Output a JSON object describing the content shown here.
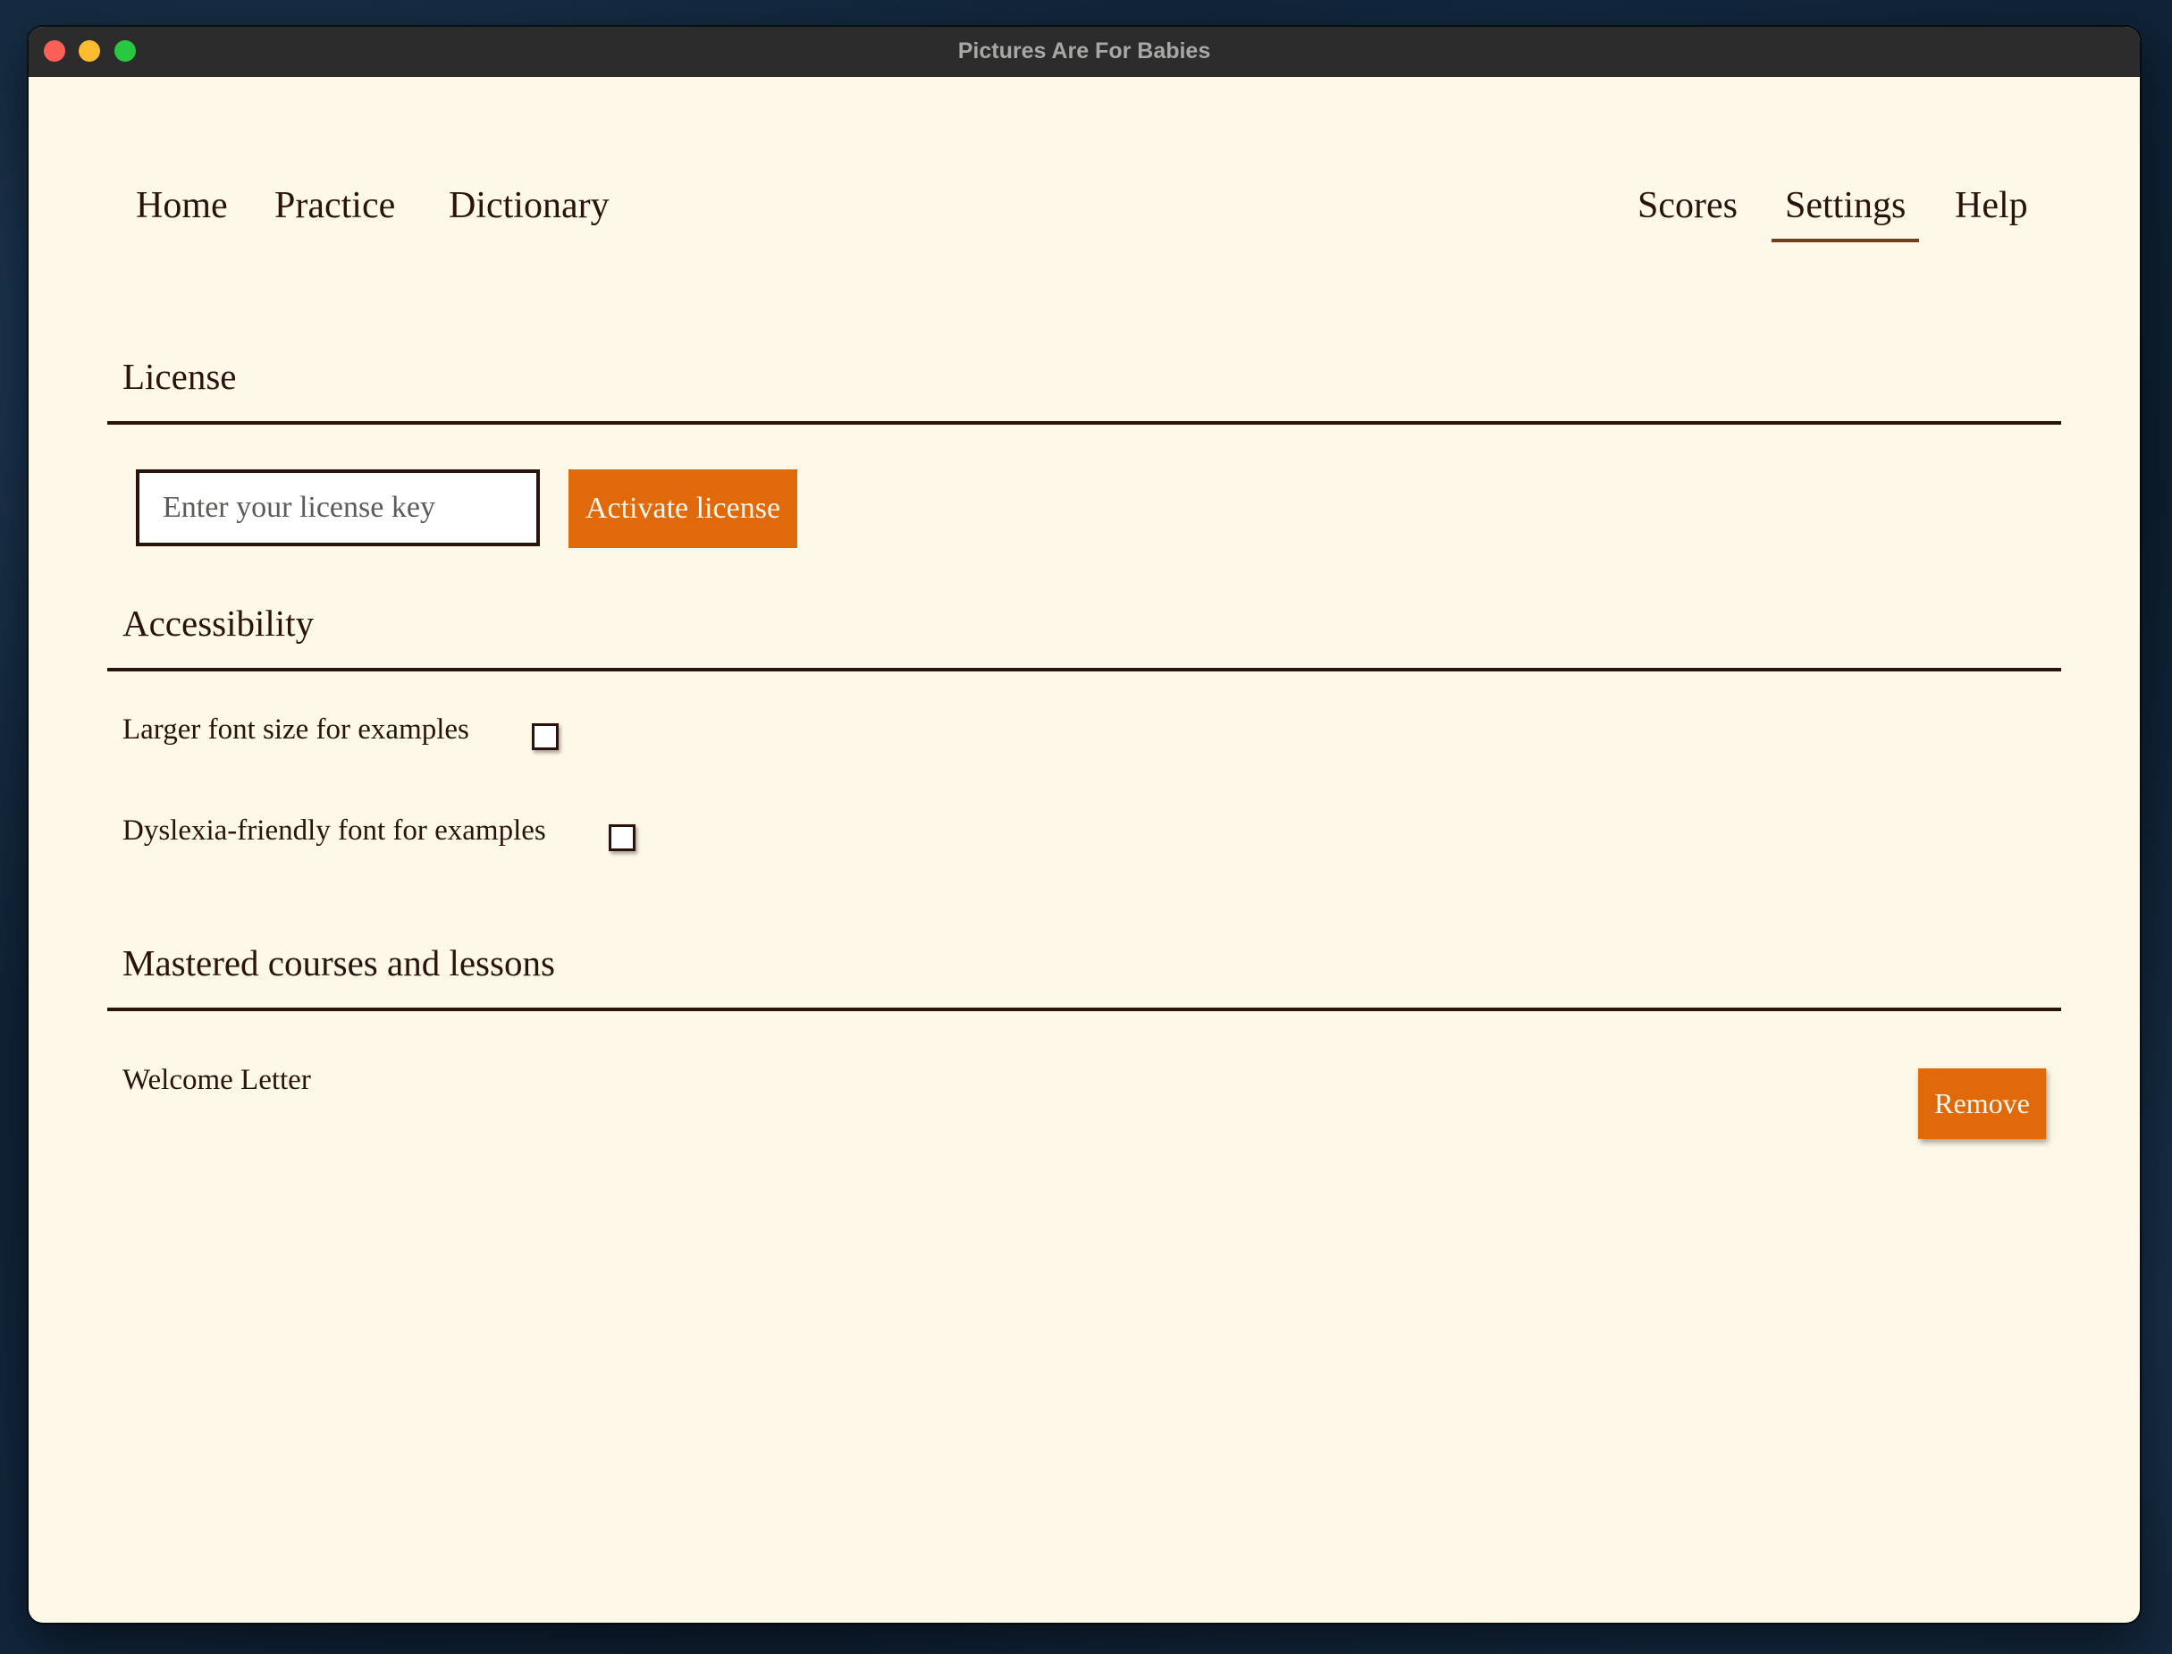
{
  "window": {
    "title": "Pictures Are For Babies"
  },
  "nav": {
    "left": [
      {
        "label": "Home"
      },
      {
        "label": "Practice"
      },
      {
        "label": "Dictionary"
      }
    ],
    "right": [
      {
        "label": "Scores"
      },
      {
        "label": "Settings",
        "active": true
      },
      {
        "label": "Help"
      }
    ]
  },
  "license": {
    "heading": "License",
    "input_placeholder": "Enter your license key",
    "input_value": "",
    "activate_label": "Activate license"
  },
  "accessibility": {
    "heading": "Accessibility",
    "options": [
      {
        "label": "Larger font size for examples",
        "checked": false
      },
      {
        "label": "Dyslexia-friendly font for examples",
        "checked": false
      }
    ]
  },
  "mastered": {
    "heading": "Mastered courses and lessons",
    "items": [
      {
        "label": "Welcome Letter",
        "action_label": "Remove"
      }
    ]
  },
  "colors": {
    "accent": "#e06a09",
    "text": "#2b130d",
    "background": "#fdf8e8",
    "titlebar": "#2d2c2c"
  }
}
